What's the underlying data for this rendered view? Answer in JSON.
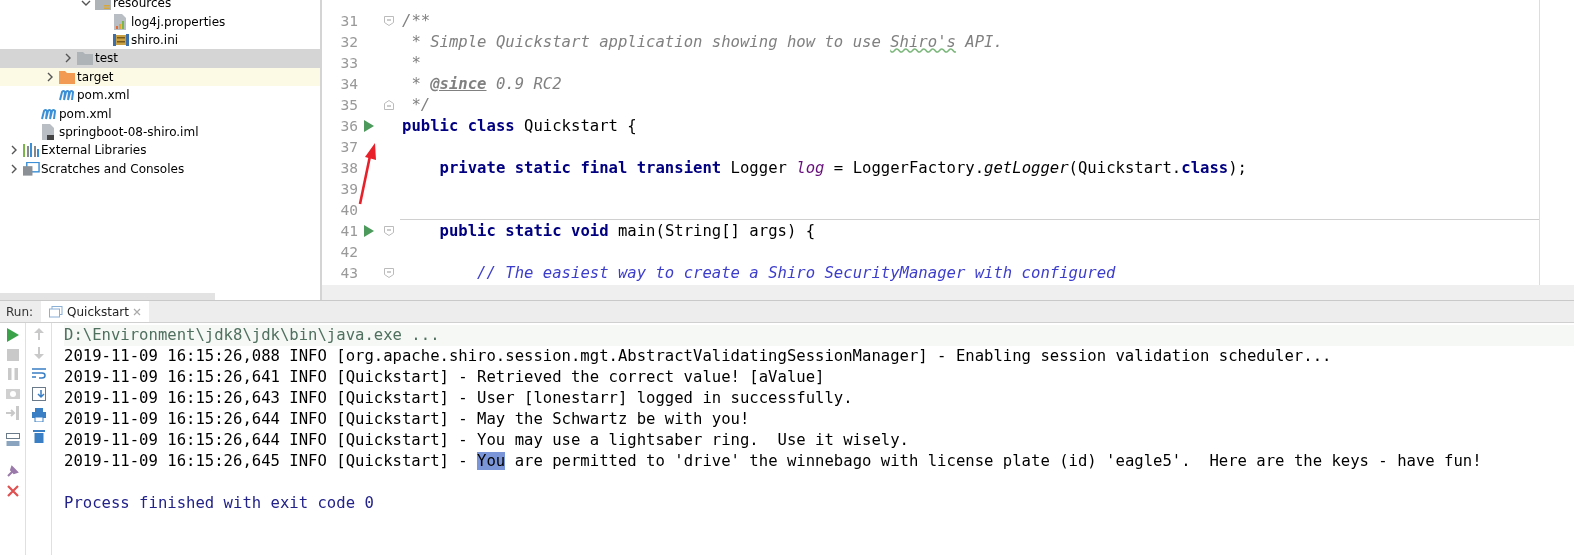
{
  "project_tree": [
    {
      "children": [
        {
          "children": [
            {
              "children": [
                {
                  "children": [
                    {
                      "label": "resources",
                      "kind": "resources-folder",
                      "expanded": true,
                      "children": [
                        {
                          "label": "log4j.properties",
                          "kind": "properties-file"
                        },
                        {
                          "label": "shiro.ini",
                          "kind": "ini-file"
                        }
                      ]
                    }
                  ]
                },
                {
                  "label": "test",
                  "kind": "folder",
                  "expanded": false,
                  "selected": true
                }
              ]
            },
            {
              "label": "target",
              "kind": "excluded-folder",
              "expanded": false,
              "highlighted": true
            },
            {
              "label": "pom.xml",
              "kind": "maven-file"
            }
          ]
        },
        {
          "label": "pom.xml",
          "kind": "maven-file"
        },
        {
          "label": "springboot-08-shiro.iml",
          "kind": "module-file"
        }
      ]
    },
    {
      "label": "External Libraries",
      "kind": "libraries",
      "expanded": false
    },
    {
      "label": "Scratches and Consoles",
      "kind": "scratches",
      "expanded": false
    }
  ],
  "editor": {
    "lines": [
      {
        "number": "31",
        "fold_start": true,
        "segments": [
          {
            "text": "/**",
            "kind": "doc"
          }
        ]
      },
      {
        "number": "32",
        "segments": [
          {
            "text": " * Simple Quickstart application showing how to use ",
            "kind": "doc"
          },
          {
            "text": "Shiro's",
            "kind": "doc-typo"
          },
          {
            "text": " API.",
            "kind": "doc"
          }
        ]
      },
      {
        "number": "33",
        "segments": [
          {
            "text": " *",
            "kind": "doc"
          }
        ]
      },
      {
        "number": "34",
        "segments": [
          {
            "text": " * ",
            "kind": "doc"
          },
          {
            "text": "@since",
            "kind": "doc-tag"
          },
          {
            "text": " 0.9 RC2",
            "kind": "doc"
          }
        ]
      },
      {
        "number": "35",
        "fold_end": true,
        "segments": [
          {
            "text": " */",
            "kind": "doc"
          }
        ]
      },
      {
        "number": "36",
        "run": true,
        "segments": [
          {
            "text": "public class ",
            "kind": "keyword"
          },
          {
            "text": "Quickstart {",
            "kind": "plain"
          }
        ]
      },
      {
        "number": "37"
      },
      {
        "number": "38",
        "segments": [
          {
            "text": "    private static final transient ",
            "kind": "keyword"
          },
          {
            "text": "Logger ",
            "kind": "plain"
          },
          {
            "text": "log",
            "kind": "static-field"
          },
          {
            "text": " = LoggerFactory.",
            "kind": "plain"
          },
          {
            "text": "getLogger",
            "kind": "static-call"
          },
          {
            "text": "(Quickstart.",
            "kind": "plain"
          },
          {
            "text": "class",
            "kind": "keyword"
          },
          {
            "text": ");",
            "kind": "plain"
          }
        ]
      },
      {
        "number": "39"
      },
      {
        "number": "40",
        "separator": true
      },
      {
        "number": "41",
        "run": true,
        "fold_start": true,
        "segments": [
          {
            "text": "    public static void ",
            "kind": "keyword"
          },
          {
            "text": "main(String[] args) {",
            "kind": "plain"
          }
        ]
      },
      {
        "number": "42"
      },
      {
        "number": "43",
        "fold_start": true,
        "segments": [
          {
            "text": "        // The easiest way to create a Shiro SecurityManager with configured",
            "kind": "line-comment"
          }
        ]
      }
    ]
  },
  "run_panel": {
    "label": "Run:",
    "tabs": [
      {
        "label": "Quickstart",
        "selected": true
      }
    ],
    "console": [
      {
        "kind": "command",
        "segments": [
          {
            "text": "D:\\Environment\\jdk8\\jdk\\bin\\java.exe ...",
            "selected": false
          }
        ]
      },
      {
        "kind": "log",
        "segments": [
          {
            "text": "2019-11-09 16:15:26,088 INFO [org.apache.shiro.session.mgt.AbstractValidatingSessionManager] - Enabling session validation scheduler...",
            "selected": false
          }
        ]
      },
      {
        "kind": "log",
        "segments": [
          {
            "text": "2019-11-09 16:15:26,641 INFO [Quickstart] - Retrieved the correct value! [aValue]",
            "selected": false
          }
        ]
      },
      {
        "kind": "log",
        "segments": [
          {
            "text": "2019-11-09 16:15:26,643 INFO [Quickstart] - User [lonestarr] logged in successfully.",
            "selected": false
          }
        ]
      },
      {
        "kind": "log",
        "segments": [
          {
            "text": "2019-11-09 16:15:26,644 INFO [Quickstart] - May the Schwartz be with you!",
            "selected": false
          }
        ]
      },
      {
        "kind": "log",
        "segments": [
          {
            "text": "2019-11-09 16:15:26,644 INFO [Quickstart] - You may use a lightsaber ring.  Use it wisely.",
            "selected": false
          }
        ]
      },
      {
        "kind": "log",
        "segments": [
          {
            "text": "2019-11-09 16:15:26,645 INFO [Quickstart] - ",
            "selected": false
          },
          {
            "text": "You",
            "selected": true
          },
          {
            "text": " are permitted to 'drive' the winnebago with license plate (id) 'eagle5'.  Here are the keys - have fun!",
            "selected": false
          }
        ]
      },
      {
        "kind": "blank"
      },
      {
        "kind": "exit",
        "segments": [
          {
            "text": "Process finished with exit code 0",
            "selected": false
          }
        ]
      }
    ]
  }
}
